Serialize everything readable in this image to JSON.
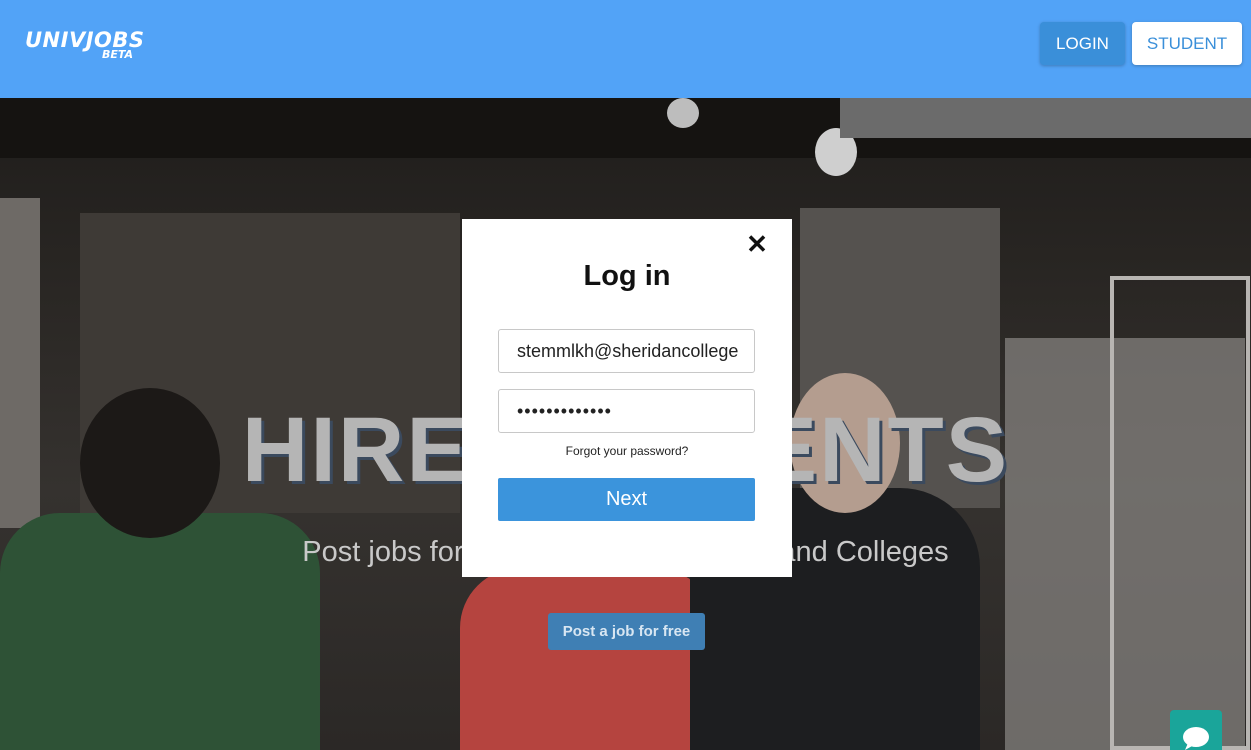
{
  "header": {
    "logo_main": "UNIVJOBS",
    "logo_sub": "BETA",
    "login_label": "LOGIN",
    "student_label": "STUDENT"
  },
  "hero": {
    "title": "HIRE STUDENTS",
    "subtitle": "Post jobs for students at Universities and Colleges",
    "post_button_label": "Post a job for free"
  },
  "modal": {
    "title": "Log in",
    "email_value": "stemmlkh@sheridancollege.ca",
    "password_value": "•••••••••••••",
    "forgot_label": "Forgot your password?",
    "next_label": "Next"
  },
  "icons": {
    "close": "close-icon",
    "chat": "chat-bubble-icon"
  },
  "colors": {
    "header": "#52a3f7",
    "primary": "#3b94dc",
    "chat": "#1aa59a"
  }
}
